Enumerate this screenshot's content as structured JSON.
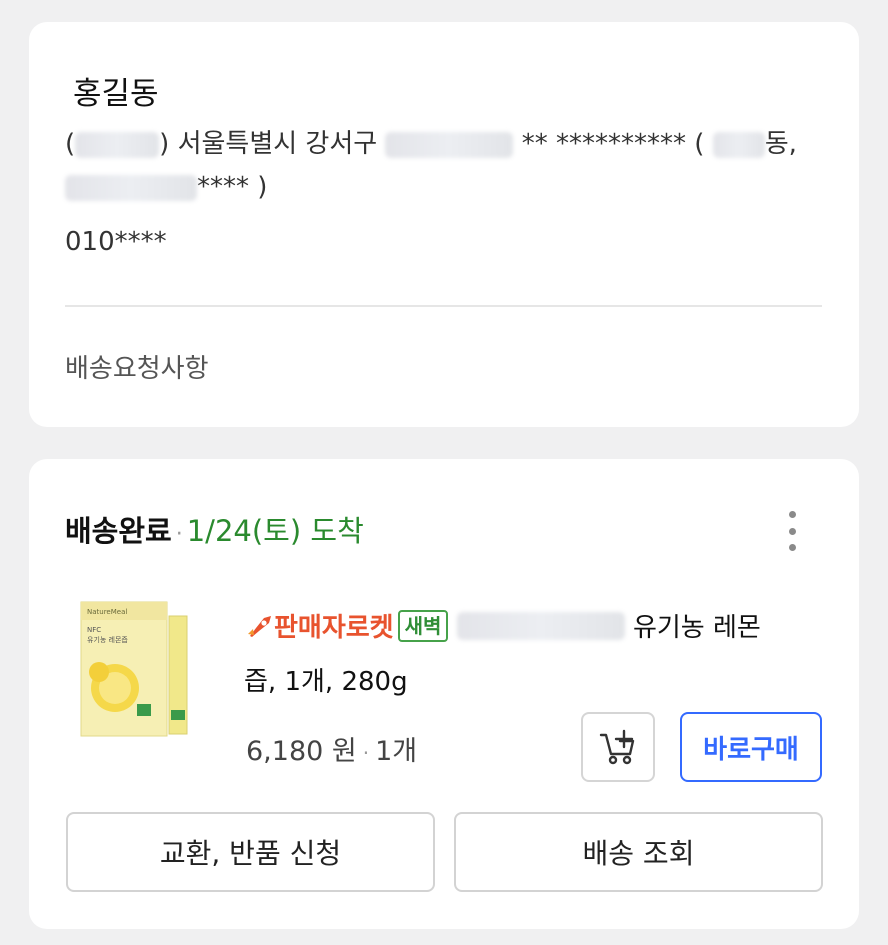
{
  "address_card": {
    "recipient_name": "홍길동",
    "address_line1_open": "(",
    "address_line1_mid": ") 서울특별시 강서구",
    "address_line1_masked": "** ********** (",
    "address_line1_end": "동,",
    "address_line2_masked": "**** )",
    "phone": "010****",
    "delivery_request_label": "배송요청사항"
  },
  "order_card": {
    "status": "배송완료",
    "status_separator": "·",
    "arrival": "1/24(토) 도착",
    "more_icon": "more-vertical-icon",
    "product": {
      "thumbnail_icon": "lemon-juice-box-thumbnail",
      "seller_badge": "판매자로켓",
      "dawn_badge": "새벽",
      "title_visible": "유기농 레몬",
      "title_line2": "즙, 1개, 280g",
      "price": "6,180 원",
      "price_separator": "·",
      "quantity": "1개"
    },
    "cart_button_icon": "add-to-cart-icon",
    "buy_now_label": "바로구매",
    "return_button_label": "교환, 반품 신청",
    "track_button_label": "배송 조회"
  },
  "colors": {
    "accent_blue": "#346aff",
    "status_green": "#2a8a2e",
    "rocket_orange": "#e8532e",
    "background": "#f0f0f1"
  }
}
